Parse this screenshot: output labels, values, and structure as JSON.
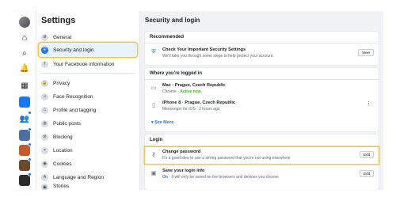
{
  "sidebar": {
    "title": "Settings",
    "items": [
      {
        "label": "General",
        "icon": "gear-icon",
        "glyph": "⚙"
      },
      {
        "label": "Security and login",
        "icon": "shield-icon",
        "glyph": "⛨"
      },
      {
        "label": "Your Facebook information",
        "icon": "facebook-icon",
        "glyph": "f"
      },
      {
        "label": "Privacy",
        "icon": "lock-icon",
        "glyph": "🔒"
      },
      {
        "label": "Face Recognition",
        "icon": "face-icon",
        "glyph": "☺"
      },
      {
        "label": "Profile and tagging",
        "icon": "tag-icon",
        "glyph": "⌂"
      },
      {
        "label": "Public posts",
        "icon": "globe-icon",
        "glyph": "◍"
      },
      {
        "label": "Blocking",
        "icon": "block-icon",
        "glyph": "⊘"
      },
      {
        "label": "Location",
        "icon": "location-pin-icon",
        "glyph": "⌖"
      },
      {
        "label": "Cookies",
        "icon": "cookie-icon",
        "glyph": "◉"
      },
      {
        "label": "Language and Region",
        "icon": "language-icon",
        "glyph": "A"
      },
      {
        "label": "Stories",
        "icon": "stories-icon",
        "glyph": "▣"
      }
    ]
  },
  "main": {
    "title": "Security and login",
    "recommended": {
      "header": "Recommended",
      "item_title": "Check Your Important Security Settings",
      "item_subtitle": "We'll take you through some steps to help protect your account.",
      "button": "View"
    },
    "logged_in": {
      "header": "Where you're logged in",
      "sessions": [
        {
          "device": "Mac · Prague, Czech Republic",
          "app": "Chrome · ",
          "status": "Active now",
          "icon": "laptop-icon"
        },
        {
          "device": "iPhone 8 · Prague, Czech Republic",
          "app": "Messenger for iOS · 2 hours ago",
          "status": "",
          "icon": "phone-icon"
        }
      ],
      "see_more": "See More"
    },
    "login": {
      "header": "Login",
      "change_password_title": "Change password",
      "change_password_subtitle": "It's a good idea to use a strong password that you're not using elsewhere",
      "save_login_title": "Save your login info",
      "save_login_on": "On",
      "save_login_subtitle": " · It will only be saved on the browsers and devices you choose",
      "edit_label": "Edit"
    }
  },
  "colors": {
    "accent": "#1877f2",
    "highlight": "#f9c53b",
    "active_green": "#42b72a"
  }
}
